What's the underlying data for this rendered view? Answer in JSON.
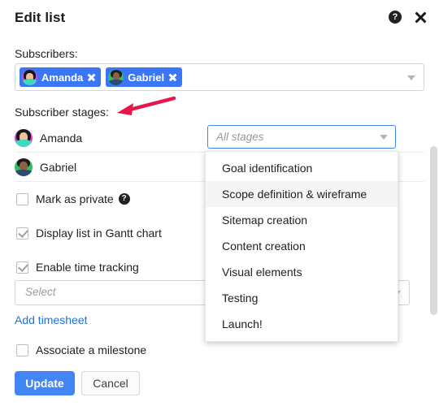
{
  "header": {
    "title": "Edit list",
    "help_icon": "help-circle-icon",
    "help_glyph": "?",
    "close_icon": "close-icon"
  },
  "subscribers": {
    "label": "Subscribers:",
    "chips": [
      {
        "name": "Amanda",
        "avatar": "amanda-avatar",
        "remove_icon": "remove-chip-icon"
      },
      {
        "name": "Gabriel",
        "avatar": "gabriel-avatar",
        "remove_icon": "remove-chip-icon"
      }
    ],
    "dropdown_icon": "chevron-down-icon"
  },
  "subscriber_stages": {
    "label": "Subscriber stages:",
    "rows": [
      {
        "name": "Amanda"
      },
      {
        "name": "Gabriel"
      }
    ],
    "stage_select": {
      "placeholder": "All stages",
      "value": "",
      "dropdown_icon": "chevron-down-icon",
      "expanded": true,
      "options": [
        "Goal identification",
        "Scope definition & wireframe",
        "Sitemap creation",
        "Content creation",
        "Visual elements",
        "Testing",
        "Launch!"
      ],
      "highlighted_option": "Scope definition & wireframe"
    }
  },
  "options": {
    "mark_private": {
      "label": "Mark as private",
      "checked": false,
      "help_glyph": "?"
    },
    "display_gantt": {
      "label": "Display list in Gantt chart",
      "checked": true
    },
    "enable_time_tracking": {
      "label": "Enable time tracking",
      "checked": true
    },
    "associate_milestone": {
      "label": "Associate a milestone",
      "checked": false
    }
  },
  "timesheet": {
    "placeholder": "Select",
    "value": "",
    "dropdown_icon": "chevron-down-icon",
    "add_link": "Add timesheet"
  },
  "footer": {
    "update_label": "Update",
    "cancel_label": "Cancel"
  },
  "colors": {
    "primary": "#4285f4",
    "chip": "#3b76f6",
    "link": "#1a73e8",
    "annotation_arrow": "#e8174a",
    "focus_border": "#4285f4"
  }
}
